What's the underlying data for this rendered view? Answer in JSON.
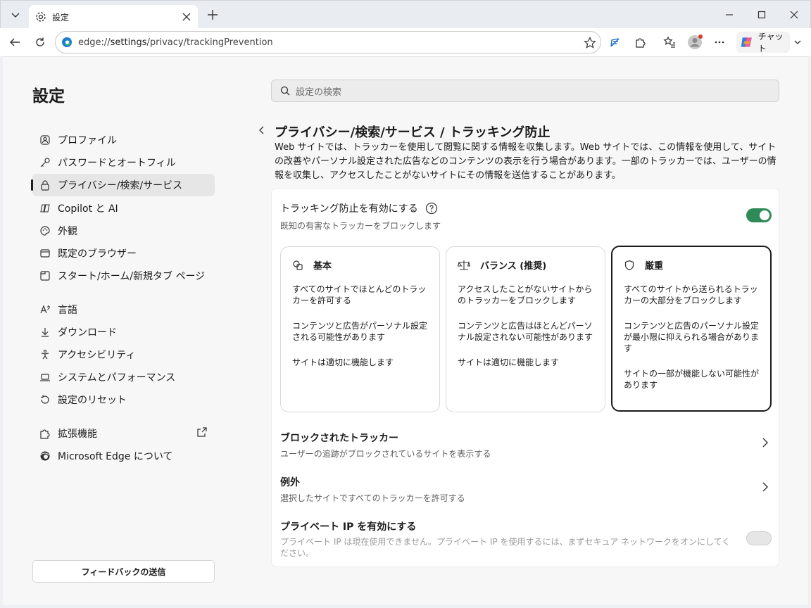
{
  "browser": {
    "tab_title": "設定",
    "url_prefix": "edge://",
    "url_host": "settings",
    "url_path": "/privacy/trackingPrevention",
    "chat_label": "チャット"
  },
  "sidebar": {
    "title": "設定",
    "items": [
      {
        "label": "プロファイル",
        "icon": "profile-icon"
      },
      {
        "label": "パスワードとオートフィル",
        "icon": "key-icon"
      },
      {
        "label": "プライバシー/検索/サービス",
        "icon": "lock-icon",
        "active": true
      },
      {
        "label": "Copilot と AI",
        "icon": "copilot-icon"
      },
      {
        "label": "外観",
        "icon": "palette-icon"
      },
      {
        "label": "既定のブラウザー",
        "icon": "browser-icon"
      },
      {
        "label": "スタート/ホーム/新規タブ ページ",
        "icon": "home-icon"
      },
      {
        "label": "言語",
        "icon": "language-icon"
      },
      {
        "label": "ダウンロード",
        "icon": "download-icon"
      },
      {
        "label": "アクセシビリティ",
        "icon": "accessibility-icon"
      },
      {
        "label": "システムとパフォーマンス",
        "icon": "laptop-icon"
      },
      {
        "label": "設定のリセット",
        "icon": "reset-icon"
      },
      {
        "label": "拡張機能",
        "icon": "puzzle-icon"
      },
      {
        "label": "Microsoft Edge について",
        "icon": "edge-icon"
      }
    ],
    "feedback_label": "フィードバックの送信"
  },
  "main": {
    "search_placeholder": "設定の検索",
    "heading": "プライバシー/検索/サービス / トラッキング防止",
    "description": "Web サイトでは、トラッカーを使用して閲覧に関する情報を収集します。Web サイトでは、この情報を使用して、サイトの改善やパーソナル設定された広告などのコンテンツの表示を行う場合があります。一部のトラッカーでは、ユーザーの情報を収集し、アクセスしたことがないサイトにその情報を送信することがあります。",
    "enable": {
      "title": "トラッキング防止を有効にする",
      "subtitle": "既知の有害なトラッカーをブロックします",
      "on": true
    },
    "levels": [
      {
        "name": "基本",
        "icon": "basic-icon",
        "lines": [
          "すべてのサイトでほとんどのトラッカーを許可する",
          "コンテンツと広告がパーソナル設定される可能性があります",
          "サイトは適切に機能します"
        ]
      },
      {
        "name": "バランス (推奨)",
        "icon": "balance-icon",
        "lines": [
          "アクセスしたことがないサイトからのトラッカーをブロックします",
          "コンテンツと広告はほとんどパーソナル設定されない可能性があります",
          "サイトは適切に機能します"
        ]
      },
      {
        "name": "厳重",
        "icon": "shield-icon",
        "selected": true,
        "lines": [
          "すべてのサイトから送られるトラッカーの大部分をブロックします",
          "コンテンツと広告のパーソナル設定が最小限に抑えられる場合があります",
          "サイトの一部が機能しない可能性があります"
        ]
      }
    ],
    "blocked": {
      "title": "ブロックされたトラッカー",
      "subtitle": "ユーザーの追跡がブロックされているサイトを表示する"
    },
    "exceptions": {
      "title": "例外",
      "subtitle": "選択したサイトですべてのトラッカーを許可する"
    },
    "private_ip": {
      "title": "プライベート IP を有効にする",
      "subtitle": "プライベート IP は現在使用できません。プライベート IP を使用するには、まずセキュア ネットワークをオンにしてください。",
      "on": false
    }
  }
}
